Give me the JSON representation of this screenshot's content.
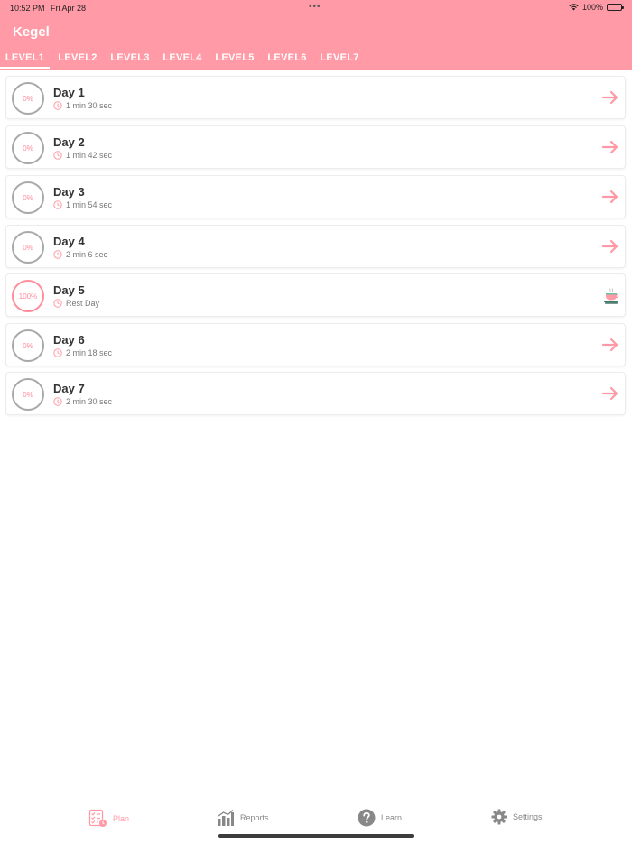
{
  "status": {
    "time": "10:52 PM",
    "date": "Fri Apr 28",
    "battery": "100%"
  },
  "app": {
    "title": "Kegel"
  },
  "tabs": [
    {
      "label": "LEVEL1"
    },
    {
      "label": "LEVEL2"
    },
    {
      "label": "LEVEL3"
    },
    {
      "label": "LEVEL4"
    },
    {
      "label": "LEVEL5"
    },
    {
      "label": "LEVEL6"
    },
    {
      "label": "LEVEL7"
    }
  ],
  "days": [
    {
      "title": "Day 1",
      "progress": "0%",
      "duration": "1 min 30 sec"
    },
    {
      "title": "Day 2",
      "progress": "0%",
      "duration": "1 min 42 sec"
    },
    {
      "title": "Day 3",
      "progress": "0%",
      "duration": "1 min 54 sec"
    },
    {
      "title": "Day 4",
      "progress": "0%",
      "duration": "2 min 6 sec"
    },
    {
      "title": "Day 5",
      "progress": "100%",
      "duration": "Rest Day"
    },
    {
      "title": "Day 6",
      "progress": "0%",
      "duration": "2 min 18 sec"
    },
    {
      "title": "Day 7",
      "progress": "0%",
      "duration": "2 min 30 sec"
    }
  ],
  "nav": {
    "plan": "Plan",
    "reports": "Reports",
    "learn": "Learn",
    "settings": "Settings"
  },
  "colors": {
    "accent": "#ff9aa6",
    "ring_inactive": "#a8a8a8"
  }
}
